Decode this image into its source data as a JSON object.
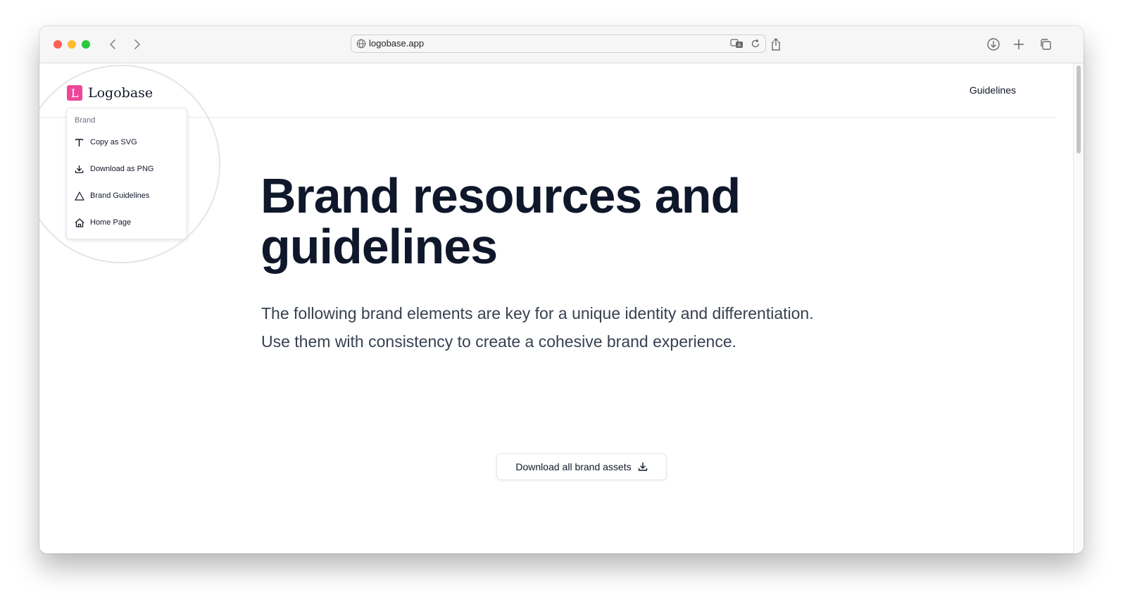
{
  "browser": {
    "url": "logobase.app"
  },
  "site": {
    "logo_letter": "L",
    "logo_text": "Logobase",
    "nav_link": "Guidelines"
  },
  "menu": {
    "label": "Brand",
    "items": [
      {
        "label": "Copy as SVG",
        "icon": "type-icon"
      },
      {
        "label": "Download as PNG",
        "icon": "download-icon"
      },
      {
        "label": "Brand Guidelines",
        "icon": "triangle-icon"
      },
      {
        "label": "Home Page",
        "icon": "home-icon"
      }
    ]
  },
  "hero": {
    "title_line1": "Brand resources and",
    "title_line2": "guidelines",
    "subtitle_line1": "The following brand elements are key for a unique identity and differentiation.",
    "subtitle_line2": "Use them with consistency to create a cohesive brand experience.",
    "cta_label": "Download all brand assets"
  },
  "colors": {
    "brand_accent": "#ec4899",
    "heading": "#0f172a",
    "body_text": "#374151"
  }
}
